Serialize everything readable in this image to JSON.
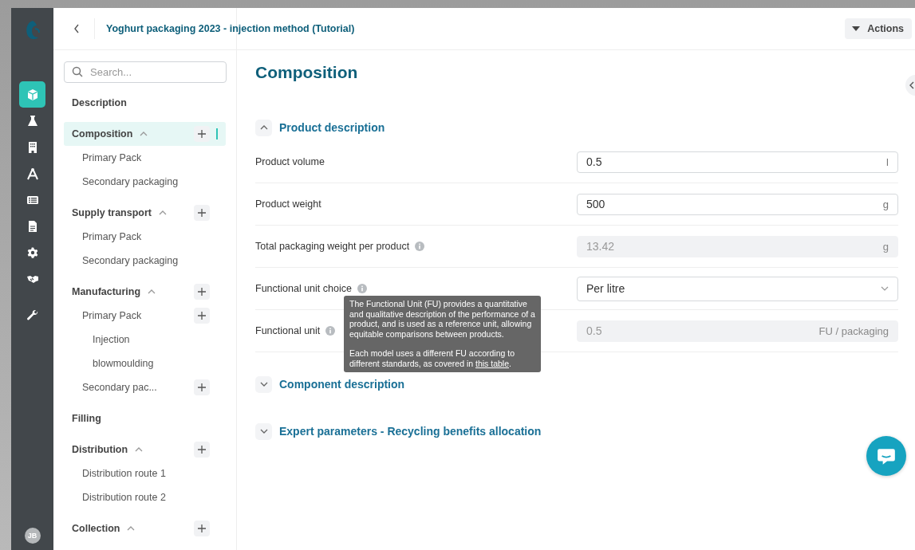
{
  "header": {
    "title": "Yoghurt packaging 2023 - injection method (Tutorial)",
    "actions": "Actions"
  },
  "rail": {
    "items": [
      {
        "selected": true
      },
      {
        "selected": false
      },
      {
        "selected": false
      },
      {
        "selected": false
      },
      {
        "selected": false
      },
      {
        "selected": false
      },
      {
        "selected": false
      },
      {
        "selected": false
      },
      {
        "selected": false
      }
    ],
    "avatar": "JB"
  },
  "search": {
    "placeholder": "Search..."
  },
  "nav": [
    {
      "label": "Description",
      "selected": false,
      "add_button": false
    },
    {
      "label": "Composition",
      "selected": true,
      "expanded": true,
      "add_button": true,
      "children": [
        {
          "label": "Primary Pack",
          "selected": false,
          "add_button": false
        },
        {
          "label": "Secondary packaging",
          "selected": false,
          "add_button": false
        }
      ]
    },
    {
      "label": "Supply transport",
      "selected": false,
      "expanded": true,
      "add_button": true,
      "children": [
        {
          "label": "Primary Pack",
          "selected": false,
          "add_button": false
        },
        {
          "label": "Secondary packaging",
          "selected": false,
          "add_button": false
        }
      ]
    },
    {
      "label": "Manufacturing",
      "selected": false,
      "expanded": true,
      "add_button": true,
      "children": [
        {
          "label": "Primary Pack",
          "selected": false,
          "add_button": true,
          "children": [
            {
              "label": "Injection",
              "selected": false,
              "add_button": false
            },
            {
              "label": "blowmoulding",
              "selected": false,
              "add_button": false
            }
          ]
        },
        {
          "label": "Secondary pac...",
          "selected": false,
          "add_button": true
        }
      ]
    },
    {
      "label": "Filling",
      "selected": false,
      "add_button": false
    },
    {
      "label": "Distribution",
      "selected": false,
      "expanded": true,
      "add_button": true,
      "children": [
        {
          "label": "Distribution route 1",
          "selected": false,
          "add_button": false
        },
        {
          "label": "Distribution route 2",
          "selected": false,
          "add_button": false
        }
      ]
    },
    {
      "label": "Collection",
      "selected": false,
      "expanded": true,
      "add_button": true
    }
  ],
  "main": {
    "title": "Composition",
    "sections": [
      {
        "title": "Product description",
        "expanded": true,
        "fields": [
          {
            "label": "Product volume",
            "info": false,
            "kind": "input",
            "value": "0.5",
            "unit": "l"
          },
          {
            "label": "Product weight",
            "info": false,
            "kind": "input",
            "value": "500",
            "unit": "g"
          },
          {
            "label": "Total packaging weight per product",
            "info": true,
            "kind": "readonly",
            "value": "13.42",
            "unit": "g"
          },
          {
            "label": "Functional unit choice",
            "info": true,
            "kind": "select",
            "value": "Per litre"
          },
          {
            "label": "Functional unit",
            "info": true,
            "kind": "readonly",
            "value": "0.5",
            "unit": "FU / packaging"
          }
        ]
      },
      {
        "title": "Component description",
        "expanded": false
      },
      {
        "title": "Expert parameters - Recycling benefits allocation",
        "expanded": false
      }
    ]
  },
  "tooltip": {
    "paragraph": "The Functional Unit (FU) provides a quantitative and qualitative description of the performance of a product, and is used as a reference unit, allowing equitable comparisons between products.",
    "note": "Each model uses a different FU according to different standards, as covered in",
    "link": "this table",
    "note_end": "."
  }
}
